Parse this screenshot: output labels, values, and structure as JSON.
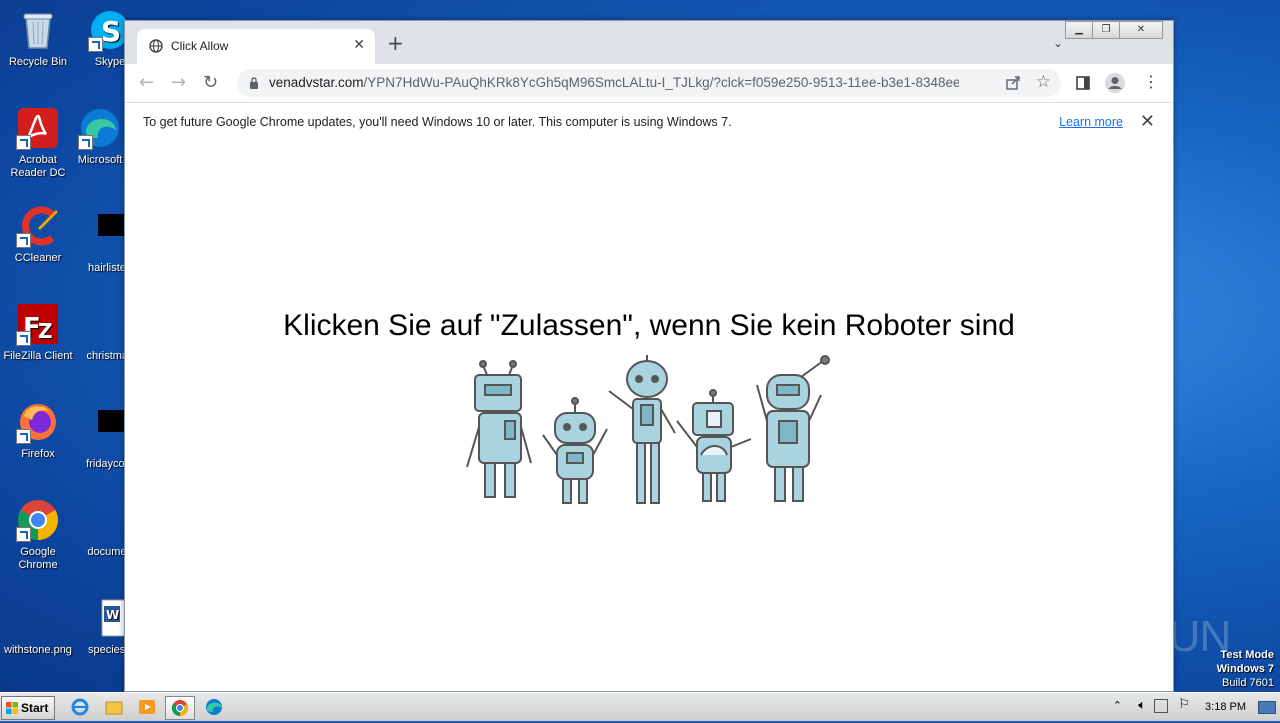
{
  "desktop": {
    "icons": [
      {
        "label": "Recycle Bin"
      },
      {
        "label": "Skype"
      },
      {
        "label": "Acrobat Reader DC"
      },
      {
        "label": "Microsoft"
      },
      {
        "label": "CCleaner"
      },
      {
        "label": "hairlisten"
      },
      {
        "label": "FileZilla Client"
      },
      {
        "label": "christmas"
      },
      {
        "label": "Firefox"
      },
      {
        "label": "fridaycom"
      },
      {
        "label": "Google Chrome"
      },
      {
        "label": "documen"
      },
      {
        "label": "withstone.png"
      },
      {
        "label": "speciestr"
      }
    ]
  },
  "browser": {
    "tab_title": "Click Allow",
    "url_domain": "venadvstar.com",
    "url_path": "/YPN7HdWu-PAuQhKRk8YcGh5qM96SmcLALtu-I_TJLkg/?clck=f059e250-9513-11ee-b3e1-8348ee...",
    "infobar_message": "To get future Google Chrome updates, you'll need Windows 10 or later. This computer is using Windows 7.",
    "infobar_link": "Learn more"
  },
  "page": {
    "headline": "Klicken Sie auf \"Zulassen\", wenn Sie kein Roboter sind"
  },
  "taskbar": {
    "start_label": "Start",
    "clock": "3:18 PM"
  },
  "overlay": {
    "watermark": "ANY RUN",
    "test_mode_line1": "Test Mode",
    "test_mode_line2": "Windows 7",
    "test_mode_line3": "Build 7601"
  },
  "colors": {
    "link": "#1a73e8",
    "tabstrip": "#dee1e6",
    "robot_fill": "#a9d3df",
    "robot_stroke": "#555555"
  },
  "icons": [
    "globe-icon",
    "close-icon",
    "plus-icon",
    "chevron-down-icon",
    "back-arrow-icon",
    "forward-arrow-icon",
    "reload-icon",
    "lock-icon",
    "share-icon",
    "star-icon",
    "side-panel-icon",
    "profile-icon",
    "kebab-menu-icon",
    "windows-flag-icon"
  ]
}
